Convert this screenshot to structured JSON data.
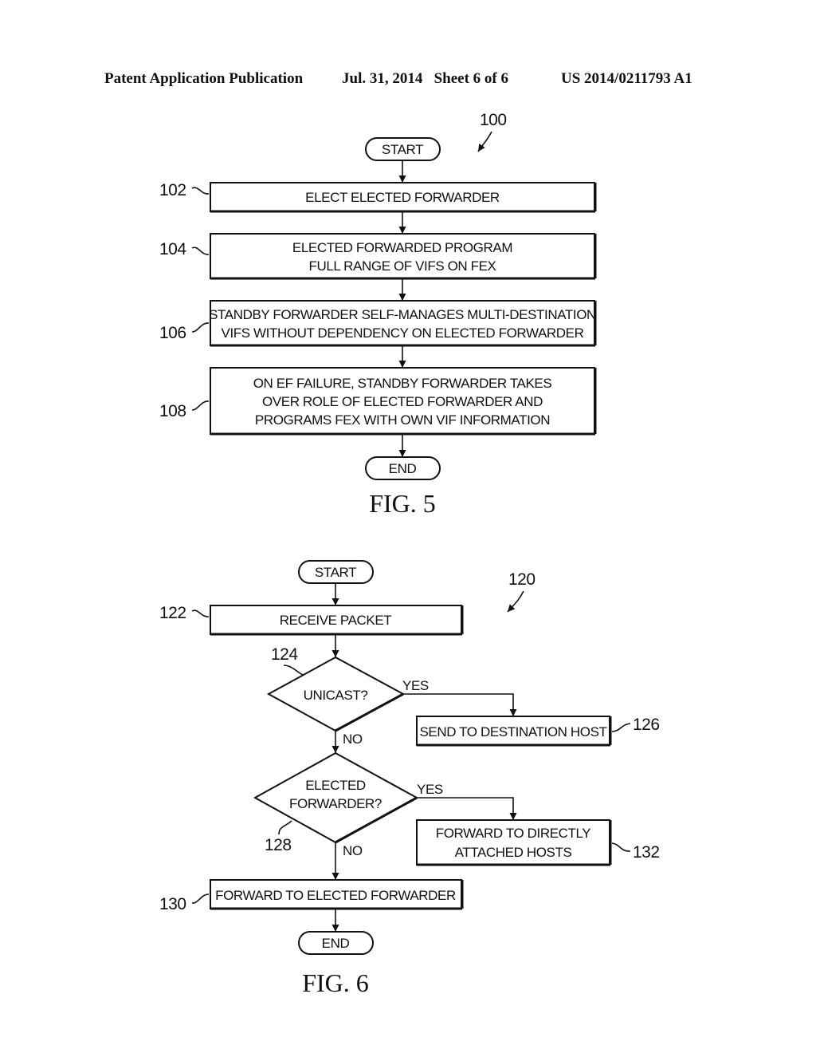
{
  "header": {
    "publication": "Patent Application Publication",
    "date_sheet": "Jul. 31, 2014   Sheet 6 of 6",
    "number": "US 2014/0211793 A1"
  },
  "fig5": {
    "caption": "FIG. 5",
    "ref": "100",
    "start": "START",
    "end": "END",
    "steps": [
      {
        "ref": "102",
        "lines": [
          "ELECT ELECTED FORWARDER"
        ]
      },
      {
        "ref": "104",
        "lines": [
          "ELECTED FORWARDED PROGRAM",
          "FULL RANGE OF VIFS ON FEX"
        ]
      },
      {
        "ref": "106",
        "lines": [
          "STANDBY FORWARDER SELF-MANAGES MULTI-DESTINATION",
          "VIFS WITHOUT DEPENDENCY ON ELECTED FORWARDER"
        ]
      },
      {
        "ref": "108",
        "lines": [
          "ON EF FAILURE, STANDBY FORWARDER TAKES",
          "OVER ROLE OF ELECTED FORWARDER AND",
          "PROGRAMS FEX WITH OWN VIF INFORMATION"
        ]
      }
    ]
  },
  "fig6": {
    "caption": "FIG. 6",
    "ref": "120",
    "start": "START",
    "end": "END",
    "receive": {
      "ref": "122",
      "text": "RECEIVE PACKET"
    },
    "decision1": {
      "ref": "124",
      "text": "UNICAST?",
      "yes": "YES",
      "no": "NO"
    },
    "send_host": {
      "ref": "126",
      "text": "SEND TO DESTINATION HOST"
    },
    "decision2": {
      "ref": "128",
      "lines": [
        "ELECTED",
        "FORWARDER?"
      ],
      "yes": "YES",
      "no": "NO"
    },
    "forward_direct": {
      "ref": "132",
      "lines": [
        "FORWARD TO DIRECTLY",
        "ATTACHED HOSTS"
      ]
    },
    "forward_ef": {
      "ref": "130",
      "text": "FORWARD TO ELECTED FORWARDER"
    }
  }
}
